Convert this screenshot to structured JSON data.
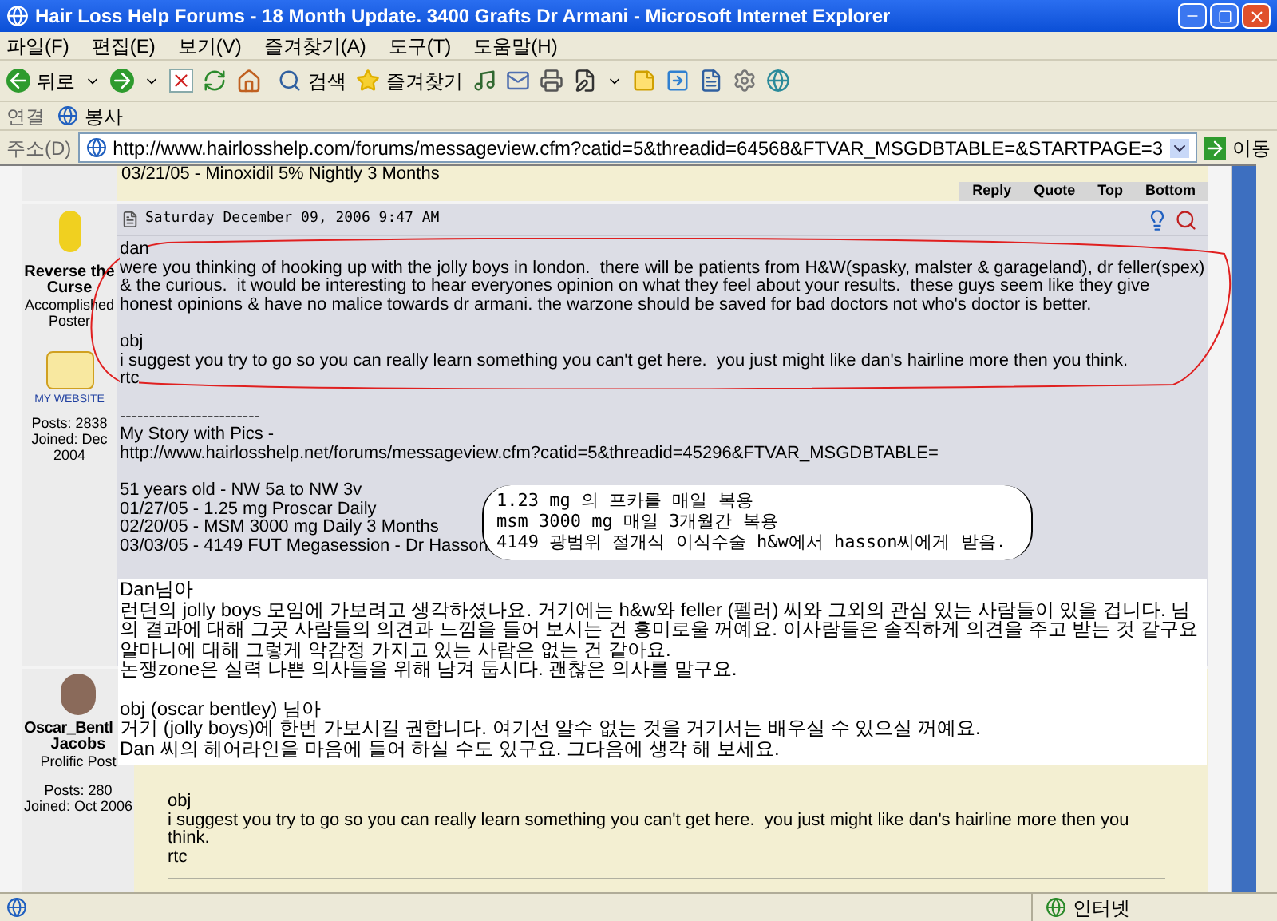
{
  "window": {
    "title": "Hair Loss Help Forums - 18 Month Update. 3400 Grafts Dr Armani - Microsoft Internet Explorer"
  },
  "menu": [
    "파일(F)",
    "편집(E)",
    "보기(V)",
    "즐겨찾기(A)",
    "도구(T)",
    "도움말(H)"
  ],
  "toolbar": {
    "back": "뒤로",
    "search": "검색",
    "favorites": "즐겨찾기"
  },
  "links_bar": {
    "label": "연결",
    "items": [
      "봉사"
    ]
  },
  "address_bar": {
    "label": "주소(D)",
    "url": "http://www.hairlosshelp.com/forums/messageview.cfm?catid=5&threadid=64568&FTVAR_MSGDBTABLE=&STARTPAGE=3",
    "go": "이동"
  },
  "previous_post": {
    "last_line": "03/21/05 - Minoxidil 5% Nightly 3 Months",
    "actions": [
      "Reply",
      "Quote",
      "Top",
      "Bottom"
    ]
  },
  "posts": [
    {
      "author": "Reverse the Curse",
      "rank": "Accomplished Poster",
      "website": "MY WEBSITE",
      "posts": "Posts: 2838",
      "joined": "Joined: Dec 2004",
      "date": "Saturday December 09, 2006 9:47 AM",
      "blocks": [
        [
          "dan",
          "were you thinking of hooking up with the jolly boys in london.  there will be patients from H&W(spasky, malster & garageland), dr feller(spex) & the curious.  it would be interesting to hear everyones opinion on what they feel about your results.  these guys seem like they give honest opinions & have no malice towards dr armani. the warzone should be saved for bad doctors not who's doctor is better."
        ],
        [
          "obj",
          "i suggest you try to go so you can really learn something you can't get here.  you just might like dan's hairline more then you think.",
          "rtc"
        ],
        [
          "------------------------",
          "My Story with Pics -",
          "http://www.hairlosshelp.net/forums/messageview.cfm?catid=5&threadid=45296&FTVAR_MSGDBTABLE="
        ],
        [
          "51 years old - NW 5a to NW 3v",
          "01/27/05 - 1.25 mg Proscar Daily",
          "02/20/05 - MSM 3000 mg Daily 3 Months",
          "03/03/05 - 4149 FUT Megasession - Dr Hasson"
        ]
      ]
    },
    {
      "author": "Oscar_Bentl",
      "author_line2": "Jacobs",
      "rank": "Prolific Post",
      "posts": "Posts: 280",
      "joined": "Joined: Oct 2006",
      "blocks": [
        [
          "obj",
          "i suggest you try to go so you can really learn something you can't get here.  you just might like dan's hairline more then you think.",
          "rtc"
        ]
      ]
    }
  ],
  "callout": {
    "lines": [
      "1.23 mg 의 프카를 매일 복용",
      "msm 3000 mg 매일 3개월간 복용",
      "4149 광범위 절개식 이식수술 h&w에서 hasson씨에게 받음."
    ]
  },
  "translation": {
    "blocks": [
      [
        "Dan님아",
        "런던의 jolly boys 모임에 가보려고 생각하셨나요. 거기에는 h&w와 feller (펠러) 씨와 그외의 관심 있는 사람들이 있을 겁니다. 님의 결과에 대해 그곳 사람들의 의견과 느낌을 들어 보시는 건 흥미로울 꺼예요. 이사람들은 솔직하게 의견을 주고 받는 것 같구요 알마니에 대해 그렇게 악감정 가지고 있는 사람은 없는 건 같아요.",
        "논쟁zone은 실력 나쁜 의사들을 위해 남겨 둡시다. 괜찮은 의사를 말구요."
      ],
      [
        "obj (oscar bentley) 님아",
        "거기 (jolly boys)에 한번 가보시길 권합니다. 여기선 알수 없는 것을 거기서는 배우실 수 있으실 꺼예요.",
        "Dan 씨의 헤어라인을 마음에 들어 하실 수도 있구요. 그다음에 생각 해 보세요."
      ]
    ]
  },
  "status_bar": {
    "zone": "인터넷"
  }
}
